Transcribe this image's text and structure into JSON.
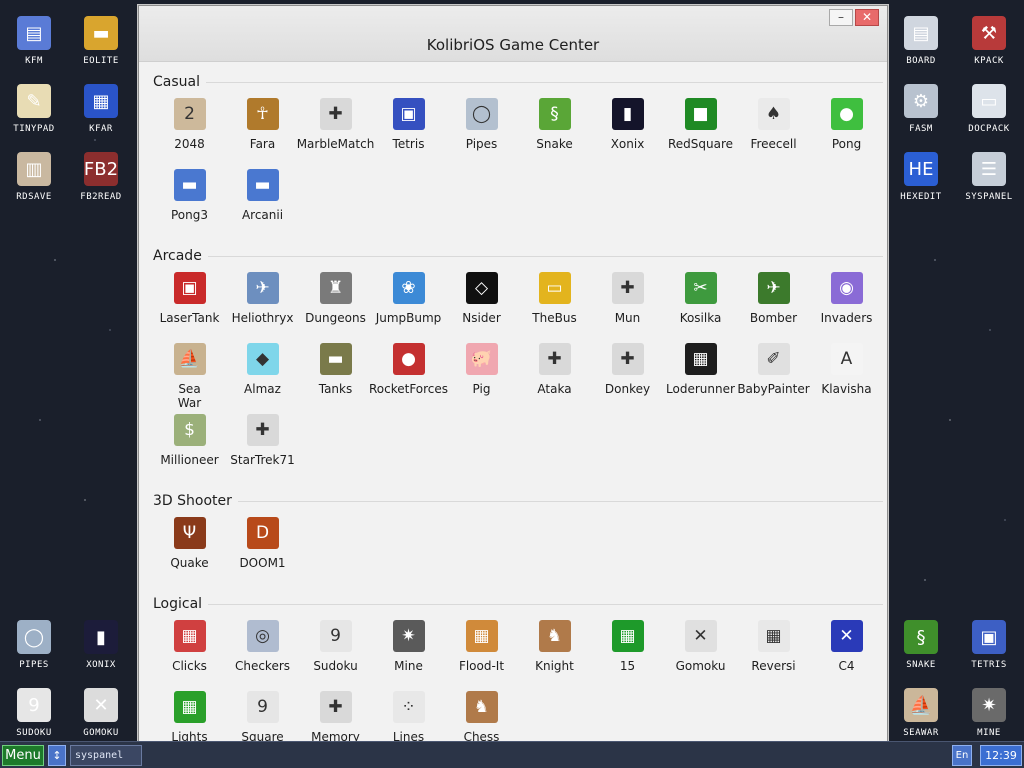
{
  "desktop": {
    "left_icons": [
      {
        "label": "KFM",
        "icon": "floppy-icon",
        "color": "#5a7bd6",
        "glyph": "▤"
      },
      {
        "label": "EOLITE",
        "icon": "folder-icon",
        "color": "#d9a52e",
        "glyph": "▬"
      },
      {
        "label": "TINYPAD",
        "icon": "notepad-icon",
        "color": "#e8dcb4",
        "glyph": "✎"
      },
      {
        "label": "KFAR",
        "icon": "kfar-icon",
        "color": "#2a54c8",
        "glyph": "▦"
      },
      {
        "label": "RDSAVE",
        "icon": "rdsave-icon",
        "color": "#c9b8a0",
        "glyph": "▥"
      },
      {
        "label": "FB2READ",
        "icon": "book-icon",
        "color": "#8c2e2e",
        "glyph": "FB2"
      },
      {
        "label": "PIPES",
        "icon": "pipes-icon",
        "color": "#9db0c6",
        "glyph": "◯"
      },
      {
        "label": "XONIX",
        "icon": "xonix-icon",
        "color": "#1c1c3a",
        "glyph": "▮"
      },
      {
        "label": "SUDOKU",
        "icon": "sudoku-icon",
        "color": "#e6e6e6",
        "glyph": "9"
      },
      {
        "label": "GOMOKU",
        "icon": "gomoku-icon",
        "color": "#dcdcdc",
        "glyph": "✕"
      }
    ],
    "right_icons": [
      {
        "label": "BOARD",
        "icon": "board-icon",
        "color": "#d0d6df",
        "glyph": "▤"
      },
      {
        "label": "KPACK",
        "icon": "kpack-icon",
        "color": "#b83a3a",
        "glyph": "⚒"
      },
      {
        "label": "FASM",
        "icon": "fasm-icon",
        "color": "#b8c2cf",
        "glyph": "⚙"
      },
      {
        "label": "DOCPACK",
        "icon": "docpack-icon",
        "color": "#dde3ea",
        "glyph": "▭"
      },
      {
        "label": "HEXEDIT",
        "icon": "hexedit-icon",
        "color": "#2b5fd4",
        "glyph": "HE"
      },
      {
        "label": "SYSPANEL",
        "icon": "syspanel-icon",
        "color": "#c6ced8",
        "glyph": "☰"
      },
      {
        "label": "SNAKE",
        "icon": "snake-icon",
        "color": "#3f8f2b",
        "glyph": "§"
      },
      {
        "label": "TETRIS",
        "icon": "tetris-icon",
        "color": "#3d5fc4",
        "glyph": "▣"
      },
      {
        "label": "SEAWAR",
        "icon": "ship-icon",
        "color": "#cbb79a",
        "glyph": "⛵"
      },
      {
        "label": "MINE",
        "icon": "mine-icon",
        "color": "#6a6a6a",
        "glyph": "✷"
      }
    ]
  },
  "window": {
    "title": "KolibriOS Game Center",
    "min_label": "–",
    "close_label": "✕"
  },
  "sections": [
    {
      "title": "Casual",
      "games": [
        {
          "label": "2048",
          "icon": "2048-icon",
          "color": "#cdb99b",
          "glyph": "2"
        },
        {
          "label": "Fara",
          "icon": "fara-icon",
          "color": "#b07a2c",
          "glyph": "☥"
        },
        {
          "label": "MarbleMatch",
          "icon": "gamepad-icon",
          "color": "#d9d9d9",
          "glyph": "✚"
        },
        {
          "label": "Tetris",
          "icon": "tetris-icon",
          "color": "#3550c0",
          "glyph": "▣"
        },
        {
          "label": "Pipes",
          "icon": "pipes-icon",
          "color": "#b3c0cf",
          "glyph": "◯"
        },
        {
          "label": "Snake",
          "icon": "snake-icon",
          "color": "#5aa637",
          "glyph": "§"
        },
        {
          "label": "Xonix",
          "icon": "xonix-icon",
          "color": "#14142a",
          "glyph": "▮"
        },
        {
          "label": "RedSquare",
          "icon": "redsquare-icon",
          "color": "#1f8a24",
          "glyph": "■"
        },
        {
          "label": "Freecell",
          "icon": "cards-icon",
          "color": "#eaeaea",
          "glyph": "♠"
        },
        {
          "label": "Pong",
          "icon": "ball-icon",
          "color": "#3fbf3f",
          "glyph": "●"
        },
        {
          "label": "Pong3",
          "icon": "paddle-icon",
          "color": "#4a78d0",
          "glyph": "▬"
        },
        {
          "label": "Arcanii",
          "icon": "paddle-icon",
          "color": "#4a78d0",
          "glyph": "▬"
        }
      ]
    },
    {
      "title": "Arcade",
      "games": [
        {
          "label": "LaserTank",
          "icon": "tank-icon",
          "color": "#c92a2a",
          "glyph": "▣"
        },
        {
          "label": "Heliothryx",
          "icon": "plane-icon",
          "color": "#6d8fbf",
          "glyph": "✈"
        },
        {
          "label": "Dungeons",
          "icon": "castle-icon",
          "color": "#7a7a7a",
          "glyph": "♜"
        },
        {
          "label": "JumpBump",
          "icon": "bunny-icon",
          "color": "#3c8ad6",
          "glyph": "❀"
        },
        {
          "label": "Nsider",
          "icon": "nsider-icon",
          "color": "#101010",
          "glyph": "◇"
        },
        {
          "label": "TheBus",
          "icon": "bus-icon",
          "color": "#e3b41e",
          "glyph": "▭"
        },
        {
          "label": "Mun",
          "icon": "gamepad-icon",
          "color": "#d9d9d9",
          "glyph": "✚"
        },
        {
          "label": "Kosilka",
          "icon": "lawnmower-icon",
          "color": "#3e9a3e",
          "glyph": "✂"
        },
        {
          "label": "Bomber",
          "icon": "plane-icon",
          "color": "#3c7a2c",
          "glyph": "✈"
        },
        {
          "label": "Invaders",
          "icon": "ufo-icon",
          "color": "#8a6bd6",
          "glyph": "◉"
        },
        {
          "label": "Sea War",
          "icon": "ship-icon",
          "color": "#c8b28f",
          "glyph": "⛵"
        },
        {
          "label": "Almaz",
          "icon": "diamond-icon",
          "color": "#7fd6ea",
          "glyph": "◆"
        },
        {
          "label": "Tanks",
          "icon": "tank-icon",
          "color": "#7a7a4a",
          "glyph": "▬"
        },
        {
          "label": "RocketForces",
          "icon": "rocket-icon",
          "color": "#c43030",
          "glyph": "●"
        },
        {
          "label": "Pig",
          "icon": "pig-icon",
          "color": "#f0a7b0",
          "glyph": "🐖"
        },
        {
          "label": "Ataka",
          "icon": "gamepad-icon",
          "color": "#d9d9d9",
          "glyph": "✚"
        },
        {
          "label": "Donkey",
          "icon": "gamepad-icon",
          "color": "#d9d9d9",
          "glyph": "✚"
        },
        {
          "label": "Loderunner",
          "icon": "loderunner-icon",
          "color": "#1e1e1e",
          "glyph": "▦"
        },
        {
          "label": "BabyPainter",
          "icon": "brush-icon",
          "color": "#e0e0e0",
          "glyph": "✐"
        },
        {
          "label": "Klavisha",
          "icon": "key-icon",
          "color": "#f4f4f4",
          "glyph": "A"
        },
        {
          "label": "Millioneer",
          "icon": "money-icon",
          "color": "#9bb07a",
          "glyph": "$"
        },
        {
          "label": "StarTrek71",
          "icon": "gamepad-icon",
          "color": "#d9d9d9",
          "glyph": "✚"
        }
      ]
    },
    {
      "title": "3D Shooter",
      "games": [
        {
          "label": "Quake",
          "icon": "quake-icon",
          "color": "#8a3a1a",
          "glyph": "Ψ"
        },
        {
          "label": "DOOM1",
          "icon": "doom-icon",
          "color": "#b84a1a",
          "glyph": "D"
        }
      ]
    },
    {
      "title": "Logical",
      "games": [
        {
          "label": "Clicks",
          "icon": "blocks-icon",
          "color": "#d04040",
          "glyph": "▦"
        },
        {
          "label": "Checkers",
          "icon": "checkers-icon",
          "color": "#b0bcd0",
          "glyph": "◎"
        },
        {
          "label": "Sudoku",
          "icon": "sudoku-icon",
          "color": "#e6e6e6",
          "glyph": "9"
        },
        {
          "label": "Mine",
          "icon": "mine-icon",
          "color": "#5a5a5a",
          "glyph": "✷"
        },
        {
          "label": "Flood-It",
          "icon": "flood-icon",
          "color": "#d08a3a",
          "glyph": "▦"
        },
        {
          "label": "Knight",
          "icon": "knight-icon",
          "color": "#b07a4a",
          "glyph": "♞"
        },
        {
          "label": "15",
          "icon": "fifteen-icon",
          "color": "#1e9a2a",
          "glyph": "▦"
        },
        {
          "label": "Gomoku",
          "icon": "gomoku-icon",
          "color": "#e0e0e0",
          "glyph": "✕"
        },
        {
          "label": "Reversi",
          "icon": "reversi-icon",
          "color": "#e8e8e8",
          "glyph": "▦"
        },
        {
          "label": "C4",
          "icon": "c4-icon",
          "color": "#2a3ab8",
          "glyph": "✕"
        },
        {
          "label": "Lights",
          "icon": "lights-icon",
          "color": "#2aa02a",
          "glyph": "▦"
        },
        {
          "label": "Square",
          "icon": "square-icon",
          "color": "#e6e6e6",
          "glyph": "9"
        },
        {
          "label": "Memory",
          "icon": "gamepad-icon",
          "color": "#d9d9d9",
          "glyph": "✚"
        },
        {
          "label": "Lines",
          "icon": "lines-icon",
          "color": "#e8e8e8",
          "glyph": "⁘"
        },
        {
          "label": "Chess",
          "icon": "chess-icon",
          "color": "#b07a4a",
          "glyph": "♞"
        }
      ]
    }
  ],
  "taskbar": {
    "menu_label": "Menu",
    "switch_glyph": "↕",
    "task_label": "syspanel",
    "lang": "En",
    "clock": "12:39"
  }
}
